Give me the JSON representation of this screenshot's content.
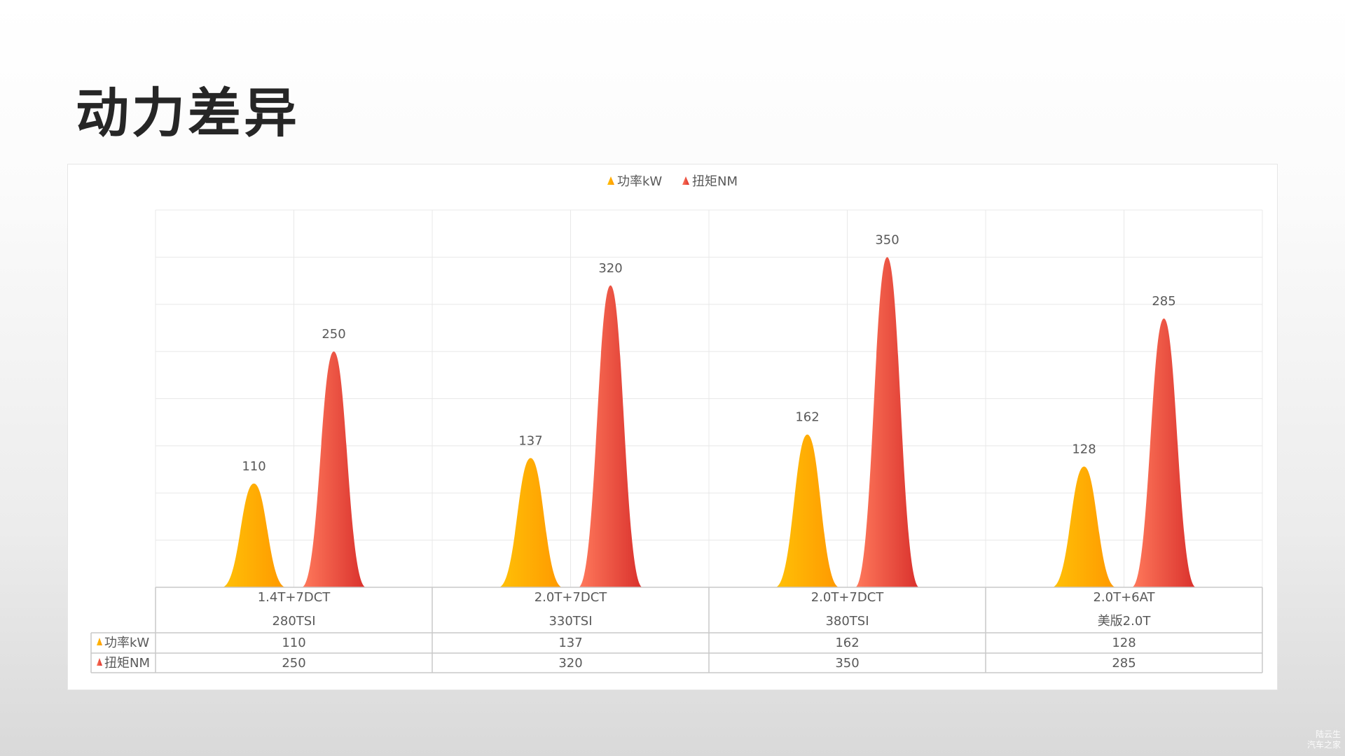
{
  "page": {
    "title": "动力差异"
  },
  "colors": {
    "power_light": "#ffc107",
    "power_dark": "#ff9800",
    "torque_light": "#ff7a5c",
    "torque_dark": "#d9302c",
    "grid": "#e8e8e8",
    "table_border": "#c9c9c9",
    "text": "#595959"
  },
  "chart_data": {
    "type": "bar",
    "categories": [
      [
        "1.4T+7DCT",
        "280TSI"
      ],
      [
        "2.0T+7DCT",
        "330TSI"
      ],
      [
        "2.0T+7DCT",
        "380TSI"
      ],
      [
        "2.0T+6AT",
        "美版2.0T"
      ]
    ],
    "series": [
      {
        "name": "功率kW",
        "values": [
          110,
          137,
          162,
          128
        ],
        "color": "#ffa600"
      },
      {
        "name": "扭矩NM",
        "values": [
          250,
          320,
          350,
          285
        ],
        "color": "#ef4b37"
      }
    ],
    "ylim": [
      0,
      400
    ],
    "grid": true,
    "legend": "top-center",
    "data_table": true,
    "bar_shape": "peak"
  },
  "watermark": {
    "line1": "陆云生",
    "line2": "汽车之家"
  }
}
